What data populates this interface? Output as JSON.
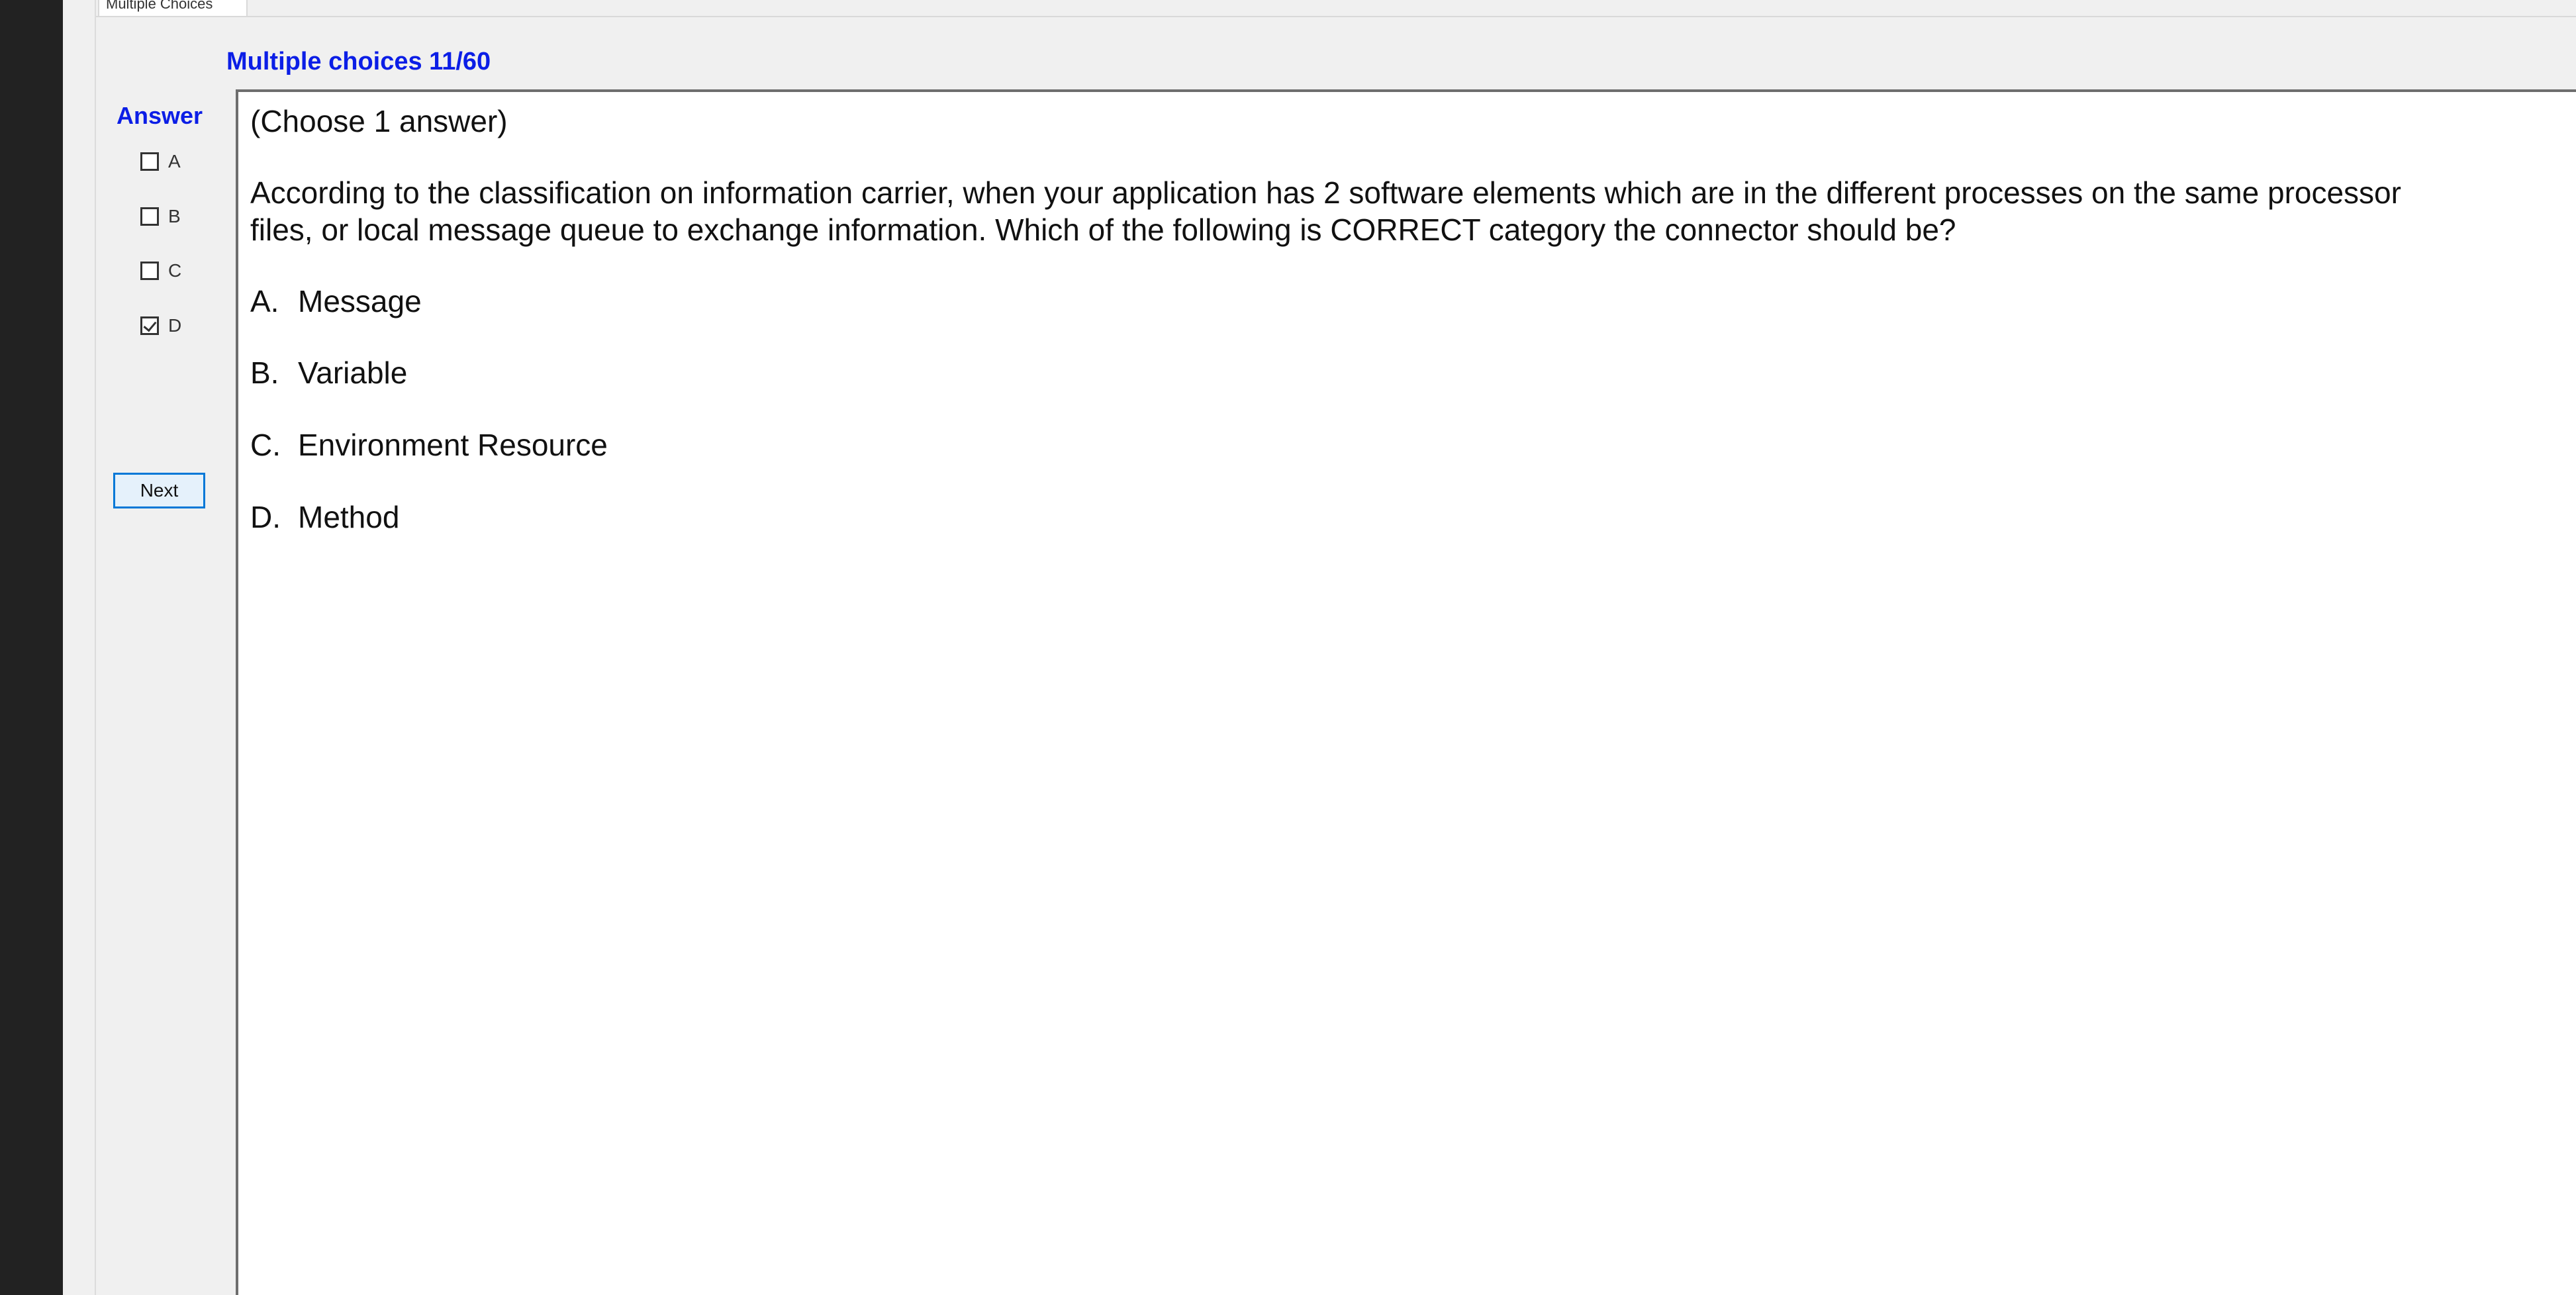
{
  "tab": {
    "label": "Multiple Choices"
  },
  "header": {
    "title": "Multiple choices 11/60"
  },
  "answer_panel": {
    "label": "Answer",
    "options": [
      {
        "letter": "A",
        "checked": false
      },
      {
        "letter": "B",
        "checked": false
      },
      {
        "letter": "C",
        "checked": false
      },
      {
        "letter": "D",
        "checked": true
      }
    ],
    "next_label": "Next"
  },
  "question": {
    "instruction": "(Choose 1 answer)",
    "line1": "According to the classification on information carrier, when your application has 2 software elements which are in the different processes on the same processor",
    "line2": "files, or local message queue to exchange information. Which of the following is CORRECT category the connector should be?",
    "choices": [
      {
        "letter": "A.",
        "text": "Message"
      },
      {
        "letter": "B.",
        "text": "Variable"
      },
      {
        "letter": "C.",
        "text": "Environment Resource"
      },
      {
        "letter": "D.",
        "text": "Method"
      }
    ]
  },
  "colors": {
    "accent": "#0b1ee6",
    "button_border": "#0078d7",
    "button_bg": "#e5f1fb"
  }
}
